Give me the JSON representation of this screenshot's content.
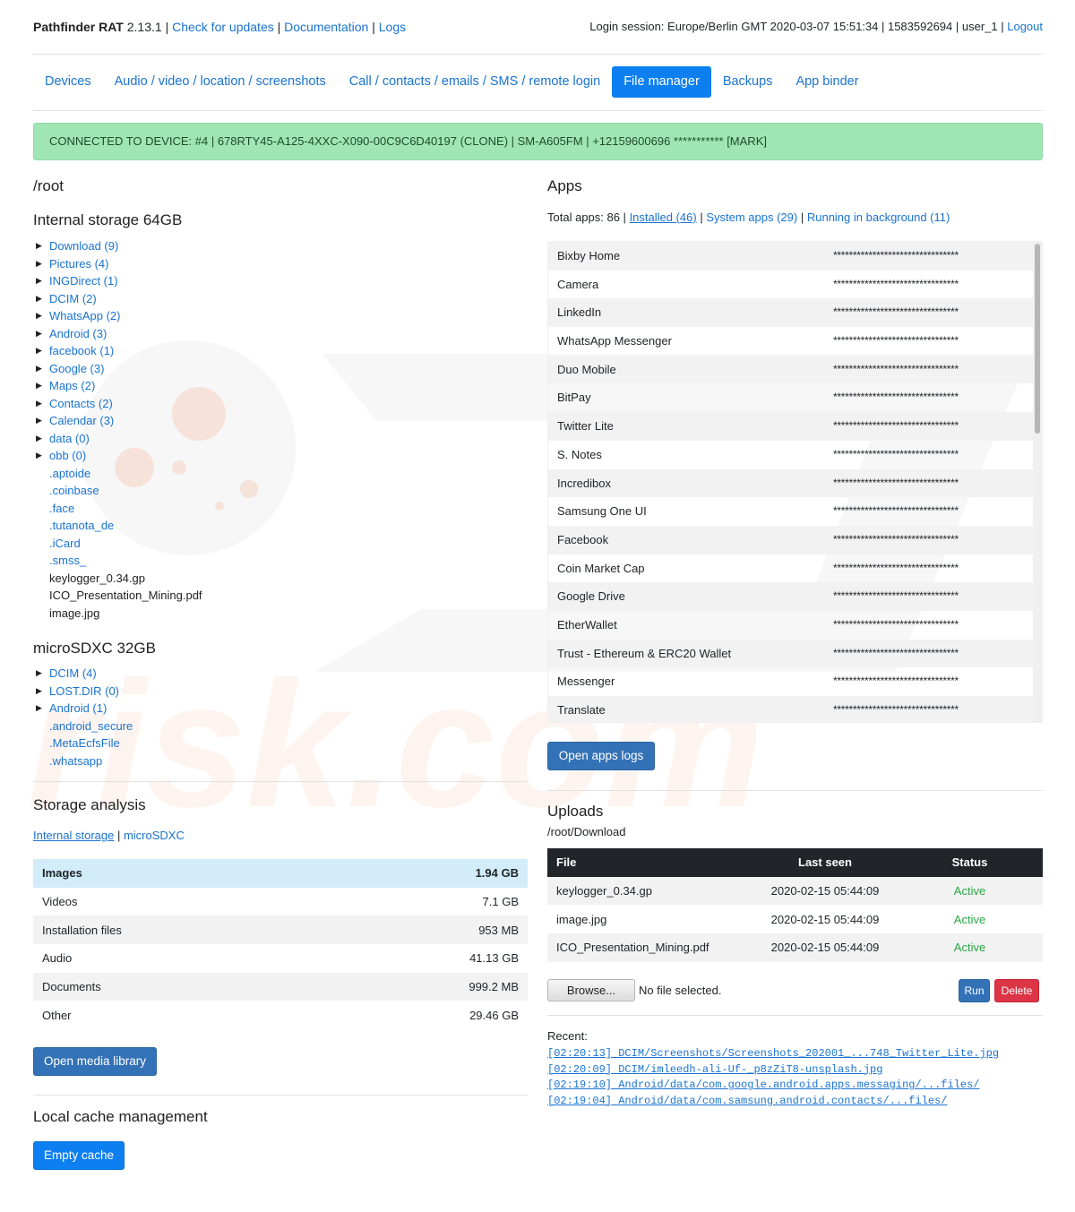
{
  "header": {
    "app_name": "Pathfinder RAT",
    "version": "2.13.1",
    "links": [
      "Check for updates",
      "Documentation",
      "Logs"
    ],
    "session_text": "Login session: Europe/Berlin GMT 2020-03-07 15:51:34 | 1583592694 | user_1 |",
    "logout_label": "Logout"
  },
  "nav": {
    "tabs": [
      "Devices",
      "Audio / video / location / screenshots",
      "Call / contacts / emails / SMS / remote login",
      "File manager",
      "Backups",
      "App binder"
    ],
    "active": "File manager"
  },
  "alert": {
    "text": "CONNECTED TO DEVICE: #4 | 678RTY45-A125-4XXC-X090-00C9C6D40197 (CLONE) | SM-A605FM | +12159600696 *********** [MARK]"
  },
  "files": {
    "path": "/root",
    "internal_title": "Internal storage 64GB",
    "internal_folders": [
      "Download (9)",
      "Pictures (4)",
      "INGDirect (1)",
      "DCIM (2)",
      "WhatsApp (2)",
      "Android (3)",
      "facebook (1)",
      "Google (3)",
      "Maps (2)",
      "Contacts (2)",
      "Calendar (3)",
      "data (0)",
      "obb (0)"
    ],
    "internal_hidden": [
      ".aptoide",
      ".coinbase",
      ".face",
      ".tutanota_de",
      ".iCard",
      ".smss_"
    ],
    "internal_files": [
      "keylogger_0.34.gp",
      "ICO_Presentation_Mining.pdf",
      "image.jpg"
    ],
    "sd_title": "microSDXC 32GB",
    "sd_folders": [
      "DCIM (4)",
      "LOST.DIR (0)",
      "Android (1)"
    ],
    "sd_hidden": [
      ".android_secure",
      ".MetaEcfsFile",
      ".whatsapp"
    ]
  },
  "storage": {
    "title": "Storage analysis",
    "tab_internal": "Internal storage",
    "tab_sd": "microSDXC",
    "rows": [
      {
        "label": "Images",
        "value": "1.94 GB"
      },
      {
        "label": "Videos",
        "value": "7.1 GB"
      },
      {
        "label": "Installation files",
        "value": "953 MB"
      },
      {
        "label": "Audio",
        "value": "41.13 GB"
      },
      {
        "label": "Documents",
        "value": "999.2 MB"
      },
      {
        "label": "Other",
        "value": "29.46 GB"
      }
    ],
    "media_button": "Open media library"
  },
  "cache": {
    "title": "Local cache management",
    "button": "Empty cache"
  },
  "apps": {
    "title": "Apps",
    "total_text": "Total apps: 86 |",
    "filter_installed": "Installed (46)",
    "filter_system": "System apps (29)",
    "filter_running": "Running in background (11)",
    "list": [
      {
        "name": "Bixby Home",
        "value": "********************************"
      },
      {
        "name": "Camera",
        "value": "********************************"
      },
      {
        "name": "LinkedIn",
        "value": "********************************"
      },
      {
        "name": "WhatsApp Messenger",
        "value": "********************************"
      },
      {
        "name": "Duo Mobile",
        "value": "********************************"
      },
      {
        "name": "BitPay",
        "value": "********************************"
      },
      {
        "name": "Twitter Lite",
        "value": "********************************"
      },
      {
        "name": "S. Notes",
        "value": "********************************"
      },
      {
        "name": "Incredibox",
        "value": "********************************"
      },
      {
        "name": "Samsung One UI",
        "value": "********************************"
      },
      {
        "name": "Facebook",
        "value": "********************************"
      },
      {
        "name": "Coin Market Cap",
        "value": "********************************"
      },
      {
        "name": "Google Drive",
        "value": "********************************"
      },
      {
        "name": "EtherWallet",
        "value": "********************************"
      },
      {
        "name": "Trust - Ethereum & ERC20 Wallet",
        "value": "********************************"
      },
      {
        "name": "Messenger",
        "value": "********************************"
      },
      {
        "name": "Translate",
        "value": "********************************"
      }
    ],
    "logs_button": "Open apps logs"
  },
  "uploads": {
    "title": "Uploads",
    "path": "/root/Download",
    "columns": [
      "File",
      "Last seen",
      "Status"
    ],
    "rows": [
      {
        "file": "keylogger_0.34.gp",
        "last_seen": "2020-02-15 05:44:09",
        "status": "Active"
      },
      {
        "file": "image.jpg",
        "last_seen": "2020-02-15 05:44:09",
        "status": "Active"
      },
      {
        "file": "ICO_Presentation_Mining.pdf",
        "last_seen": "2020-02-15 05:44:09",
        "status": "Active"
      }
    ],
    "browse_label": "Browse...",
    "no_file": "No file selected.",
    "run_label": "Run",
    "delete_label": "Delete",
    "recent_label": "Recent:",
    "recent": [
      "[02:20:13] DCIM/Screenshots/Screenshots_202001_...748_Twitter_Lite.jpg",
      "[02:20:09] DCIM/imleedh-ali-Uf-_p8zZiT8-unsplash.jpg",
      "[02:19:10] Android/data/com.google.android.apps.messaging/...files/",
      "[02:19:04] Android/data/com.samsung.android.contacts/...files/"
    ]
  },
  "colors": {
    "link": "#1a73d1",
    "active_tab": "#0d7ff0",
    "alert_bg": "#a0e6b4",
    "status_active": "#28a745",
    "delete": "#dc3545",
    "table_header": "#212529"
  }
}
